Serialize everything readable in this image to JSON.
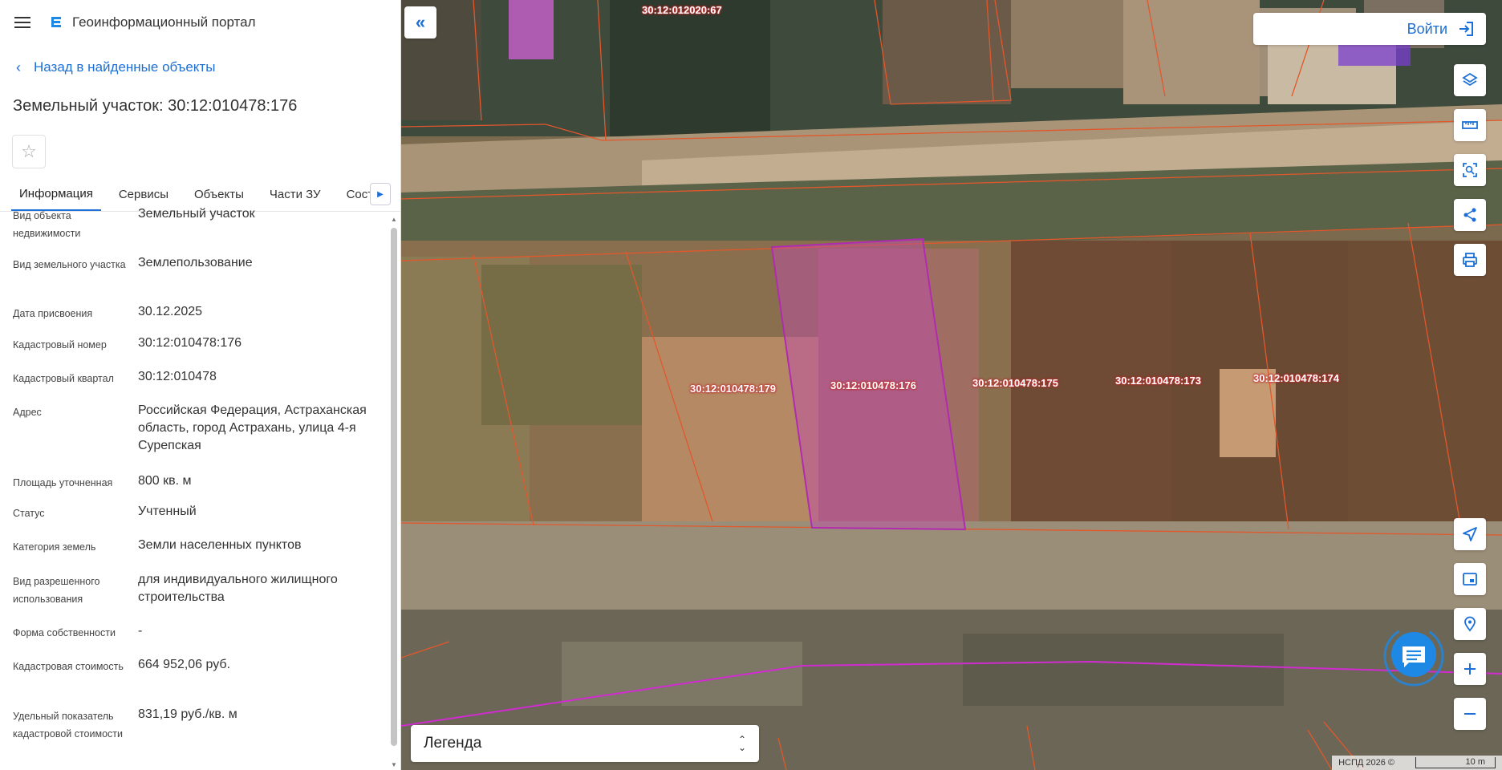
{
  "header": {
    "app_title": "Геоинформационный портал"
  },
  "back_link": {
    "label": "Назад в найденные объекты"
  },
  "object": {
    "title": "Земельный участок: 30:12:010478:176"
  },
  "tabs": [
    {
      "label": "Информация",
      "active": true
    },
    {
      "label": "Сервисы"
    },
    {
      "label": "Объекты"
    },
    {
      "label": "Части ЗУ"
    },
    {
      "label": "Состав"
    }
  ],
  "info": [
    {
      "label": "Вид объекта недвижимости",
      "value": "Земельный участок"
    },
    {
      "label": "Вид земельного участка",
      "value": "Землепользование"
    },
    {
      "label": "Дата присвоения",
      "value": "30.12.2025"
    },
    {
      "label": "Кадастровый номер",
      "value": "30:12:010478:176"
    },
    {
      "label": "Кадастровый квартал",
      "value": "30:12:010478"
    },
    {
      "label": "Адрес",
      "value": "Российская Федерация, Астраханская область, город Астрахань, улица 4-я Сурепская"
    },
    {
      "label": "Площадь уточненная",
      "value": "800 кв. м"
    },
    {
      "label": "Статус",
      "value": "Учтенный"
    },
    {
      "label": "Категория земель",
      "value": "Земли населенных пунктов"
    },
    {
      "label": "Вид разрешенного использования",
      "value": "для индивидуального жилищного строительства"
    },
    {
      "label": "Форма собственности",
      "value": "-"
    },
    {
      "label": "Кадастровая стоимость",
      "value": "664 952,06 руб."
    },
    {
      "label": "Удельный показатель кадастровой стоимости",
      "value": "831,19 руб./кв. м"
    }
  ],
  "map": {
    "parcel_labels": {
      "p179": "30:12:010478:179",
      "p176": "30:12:010478:176",
      "p175": "30:12:010478:175",
      "p173": "30:12:010478:173",
      "p174": "30:12:010478:174",
      "p67": "30:12:012020:67"
    },
    "login_label": "Войти",
    "legend_label": "Легенда",
    "attribution": "НСПД 2026 ©",
    "scale_label": "10 m",
    "selected_color": "#b02bb0",
    "parcel_border_color": "#e2572b"
  },
  "icons": {
    "menu": "hamburger-icon",
    "logo": "portal-logo-icon",
    "tools": [
      "layers-icon",
      "ruler-icon",
      "select-area-icon",
      "share-icon",
      "print-icon",
      "navigate-icon",
      "minimap-icon",
      "locate-icon",
      "zoom-in-icon",
      "zoom-out-icon"
    ]
  }
}
